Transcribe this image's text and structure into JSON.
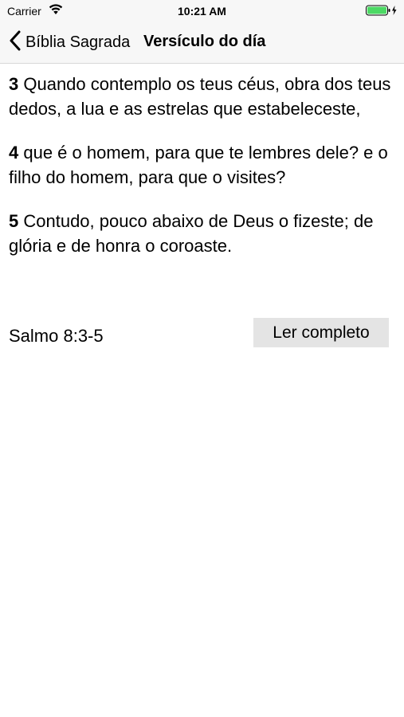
{
  "status_bar": {
    "carrier": "Carrier",
    "time": "10:21 AM",
    "wifi_icon": "wifi-icon",
    "battery_icon": "battery-charging-icon",
    "battery_color": "#4cd964"
  },
  "nav_bar": {
    "back_label": "Bíblia Sagrada",
    "back_icon": "chevron-left-icon",
    "title": "Versículo do día"
  },
  "verses": [
    {
      "number": "3",
      "text": " Quando contemplo os teus céus, obra dos teus dedos, a lua e as estrelas que estabeleceste,"
    },
    {
      "number": "4",
      "text": " que é o homem, para que te lembres dele? e o filho do homem, para que o visites?"
    },
    {
      "number": "5",
      "text": " Contudo, pouco abaixo de Deus o fizeste; de glória e de honra o coroaste."
    }
  ],
  "footer": {
    "reference": "Salmo 8:3-5",
    "read_full_label": "Ler completo"
  }
}
